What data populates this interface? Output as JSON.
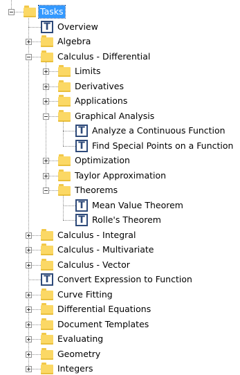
{
  "tree": {
    "rows": [
      {
        "label": "Tasks",
        "type": "folder",
        "depth": 0,
        "expanded": true,
        "selected": true
      },
      {
        "label": "Overview",
        "type": "task",
        "depth": 1
      },
      {
        "label": "Algebra",
        "type": "folder",
        "depth": 1,
        "expanded": false
      },
      {
        "label": "Calculus - Differential",
        "type": "folder",
        "depth": 1,
        "expanded": true
      },
      {
        "label": "Limits",
        "type": "folder",
        "depth": 2,
        "expanded": false
      },
      {
        "label": "Derivatives",
        "type": "folder",
        "depth": 2,
        "expanded": false
      },
      {
        "label": "Applications",
        "type": "folder",
        "depth": 2,
        "expanded": false
      },
      {
        "label": "Graphical Analysis",
        "type": "folder",
        "depth": 2,
        "expanded": true
      },
      {
        "label": "Analyze a Continuous Function",
        "type": "task",
        "depth": 3
      },
      {
        "label": "Find Special Points on a Function",
        "type": "task",
        "depth": 3
      },
      {
        "label": "Optimization",
        "type": "folder",
        "depth": 2,
        "expanded": false
      },
      {
        "label": "Taylor Approximation",
        "type": "folder",
        "depth": 2,
        "expanded": false
      },
      {
        "label": "Theorems",
        "type": "folder",
        "depth": 2,
        "expanded": true
      },
      {
        "label": "Mean Value Theorem",
        "type": "task",
        "depth": 3
      },
      {
        "label": "Rolle's Theorem",
        "type": "task",
        "depth": 3
      },
      {
        "label": "Calculus - Integral",
        "type": "folder",
        "depth": 1,
        "expanded": false
      },
      {
        "label": "Calculus - Multivariate",
        "type": "folder",
        "depth": 1,
        "expanded": false
      },
      {
        "label": "Calculus - Vector",
        "type": "folder",
        "depth": 1,
        "expanded": false
      },
      {
        "label": "Convert Expression to Function",
        "type": "task",
        "depth": 1
      },
      {
        "label": "Curve Fitting",
        "type": "folder",
        "depth": 1,
        "expanded": false
      },
      {
        "label": "Differential Equations",
        "type": "folder",
        "depth": 1,
        "expanded": false
      },
      {
        "label": "Document Templates",
        "type": "folder",
        "depth": 1,
        "expanded": false
      },
      {
        "label": "Evaluating",
        "type": "folder",
        "depth": 1,
        "expanded": false
      },
      {
        "label": "Geometry",
        "type": "folder",
        "depth": 1,
        "expanded": false
      },
      {
        "label": "Integers",
        "type": "folder",
        "depth": 1,
        "expanded": false
      }
    ],
    "task_icon_glyph": "T",
    "colors": {
      "selection": "#3399ff",
      "folder": "#fbd865",
      "task_icon": "#2e4a7a"
    }
  }
}
